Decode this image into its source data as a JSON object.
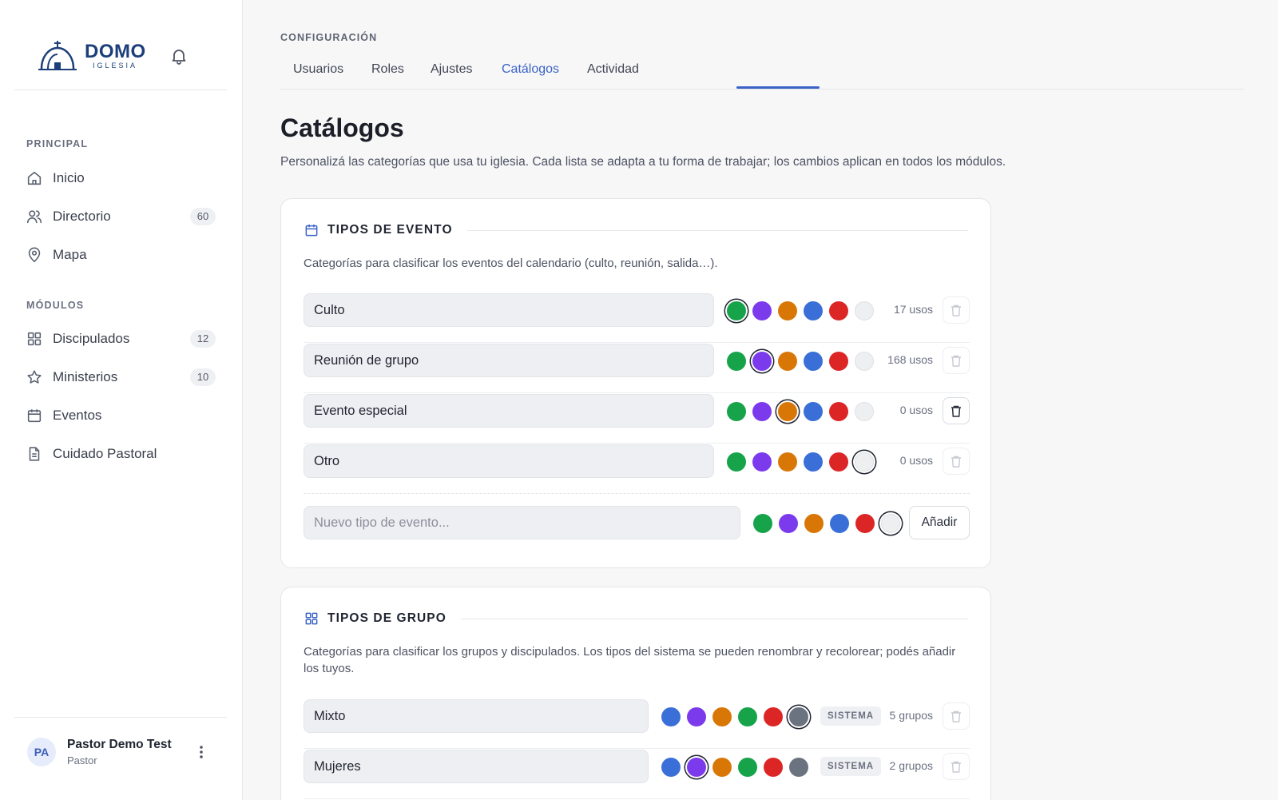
{
  "brand": {
    "name": "DOMO",
    "sub": "IGLESIA"
  },
  "sidebar": {
    "sections": [
      {
        "title": "PRINCIPAL",
        "items": [
          {
            "label": "Inicio",
            "icon": "home-icon"
          },
          {
            "label": "Directorio",
            "icon": "users-icon",
            "badge": "60"
          },
          {
            "label": "Mapa",
            "icon": "map-pin-icon"
          }
        ]
      },
      {
        "title": "MÓDULOS",
        "items": [
          {
            "label": "Discipulados",
            "icon": "grid-icon",
            "badge": "12"
          },
          {
            "label": "Ministerios",
            "icon": "star-icon",
            "badge": "10"
          },
          {
            "label": "Eventos",
            "icon": "calendar-icon"
          },
          {
            "label": "Cuidado Pastoral",
            "icon": "document-icon"
          }
        ]
      }
    ],
    "user": {
      "initials": "PA",
      "name": "Pastor Demo Test",
      "role": "Pastor"
    }
  },
  "header": {
    "eyebrow": "CONFIGURACIÓN",
    "tabs": [
      "Usuarios",
      "Roles",
      "Ajustes",
      "Catálogos",
      "Actividad"
    ],
    "active_tab": "Catálogos"
  },
  "page": {
    "title": "Catálogos",
    "description": "Personalizá las categorías que usa tu iglesia. Cada lista se adapta a tu forma de trabajar; los cambios aplican en todos los módulos."
  },
  "colors": {
    "accent": "#3b63c7",
    "event_palette": [
      "#16a34a",
      "#7c3aed",
      "#d97706",
      "#3b6fd8",
      "#dc2626",
      "#eeeff1"
    ],
    "group_palette": [
      "#3b6fd8",
      "#7c3aed",
      "#d97706",
      "#16a34a",
      "#dc2626",
      "#6b7280"
    ]
  },
  "event_types": {
    "title": "TIPOS DE EVENTO",
    "description": "Categorías para clasificar los eventos del calendario (culto, reunión, salida…).",
    "items": [
      {
        "name": "Culto",
        "selected_color": 0,
        "uses": "17 usos",
        "deletable": false
      },
      {
        "name": "Reunión de grupo",
        "selected_color": 1,
        "uses": "168 usos",
        "deletable": false
      },
      {
        "name": "Evento especial",
        "selected_color": 2,
        "uses": "0 usos",
        "deletable": true
      },
      {
        "name": "Otro",
        "selected_color": 5,
        "uses": "0 usos",
        "deletable": false
      }
    ],
    "new_placeholder": "Nuevo tipo de evento...",
    "new_selected_color": 5,
    "add_label": "Añadir"
  },
  "group_types": {
    "title": "TIPOS DE GRUPO",
    "description": "Categorías para clasificar los grupos y discipulados. Los tipos del sistema se pueden renombrar y recolorear; podés añadir los tuyos.",
    "system_label": "SISTEMA",
    "items": [
      {
        "name": "Mixto",
        "selected_color": 5,
        "count": "5 grupos"
      },
      {
        "name": "Mujeres",
        "selected_color": 1,
        "count": "2 grupos"
      }
    ]
  }
}
